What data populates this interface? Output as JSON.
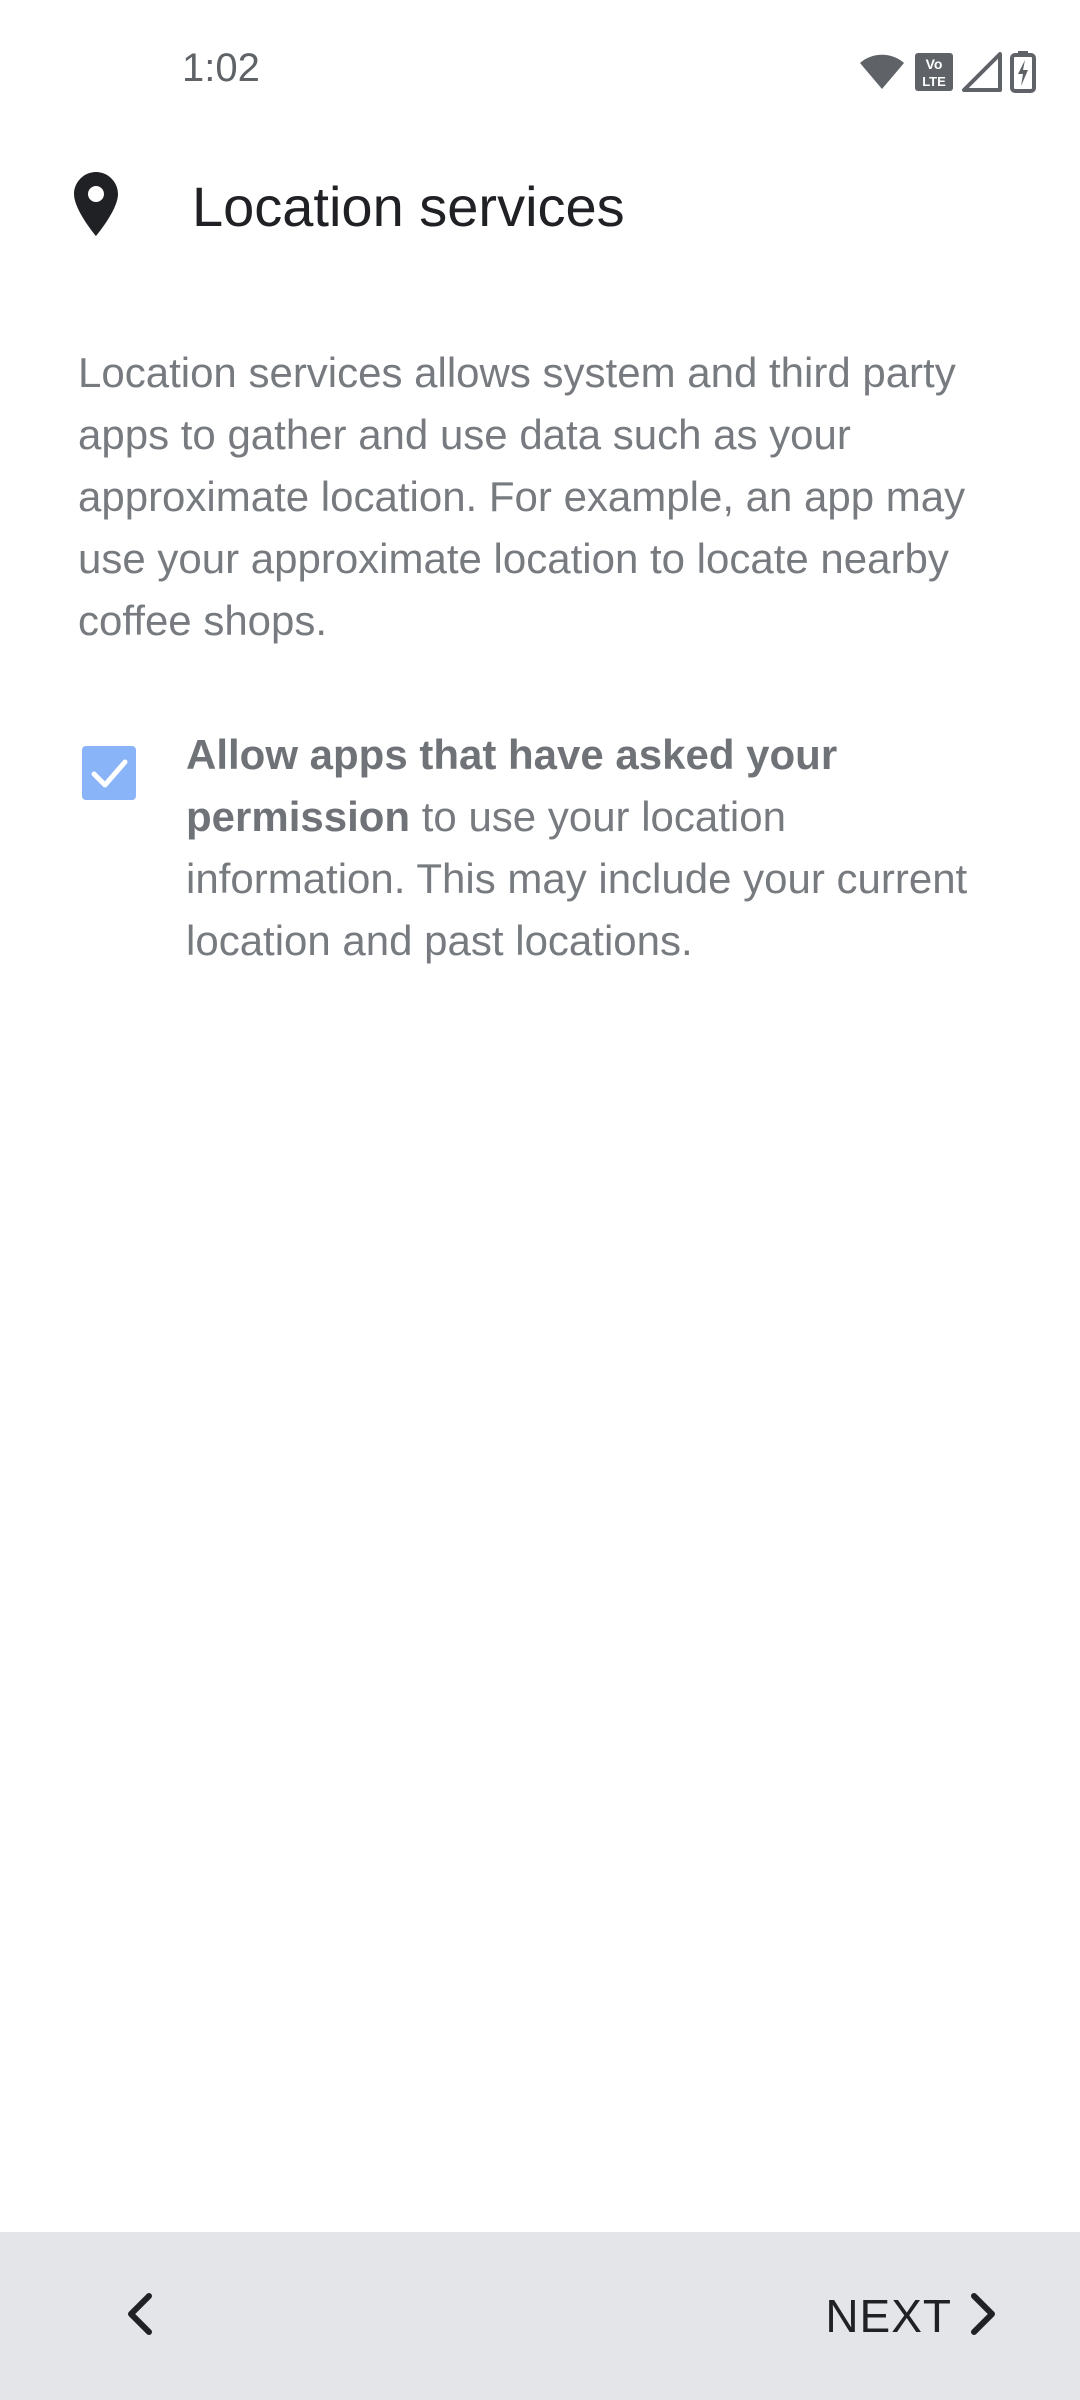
{
  "status_bar": {
    "time": "1:02",
    "icons": [
      "wifi-icon",
      "volte-icon",
      "cell-signal-icon",
      "battery-charging-icon"
    ],
    "volte_top": "Vo",
    "volte_bottom": "LTE"
  },
  "header": {
    "icon": "location-pin-icon",
    "title": "Location services"
  },
  "description": "Location services allows system and third party apps to gather and use data such as your approximate location. For example, an app may use your approximate location to locate nearby coffee shops.",
  "permission": {
    "checked": true,
    "bold_text": "Allow apps that have asked your permission",
    "rest_text": " to use your location information. This may include your current location and past locations."
  },
  "navigation": {
    "back_icon": "chevron-left-icon",
    "next_label": "NEXT",
    "next_icon": "chevron-right-icon"
  },
  "colors": {
    "accent": "#8ab4f8",
    "bottom_bar": "#e3e5e8",
    "title": "#202124",
    "body_text": "#777b80"
  }
}
